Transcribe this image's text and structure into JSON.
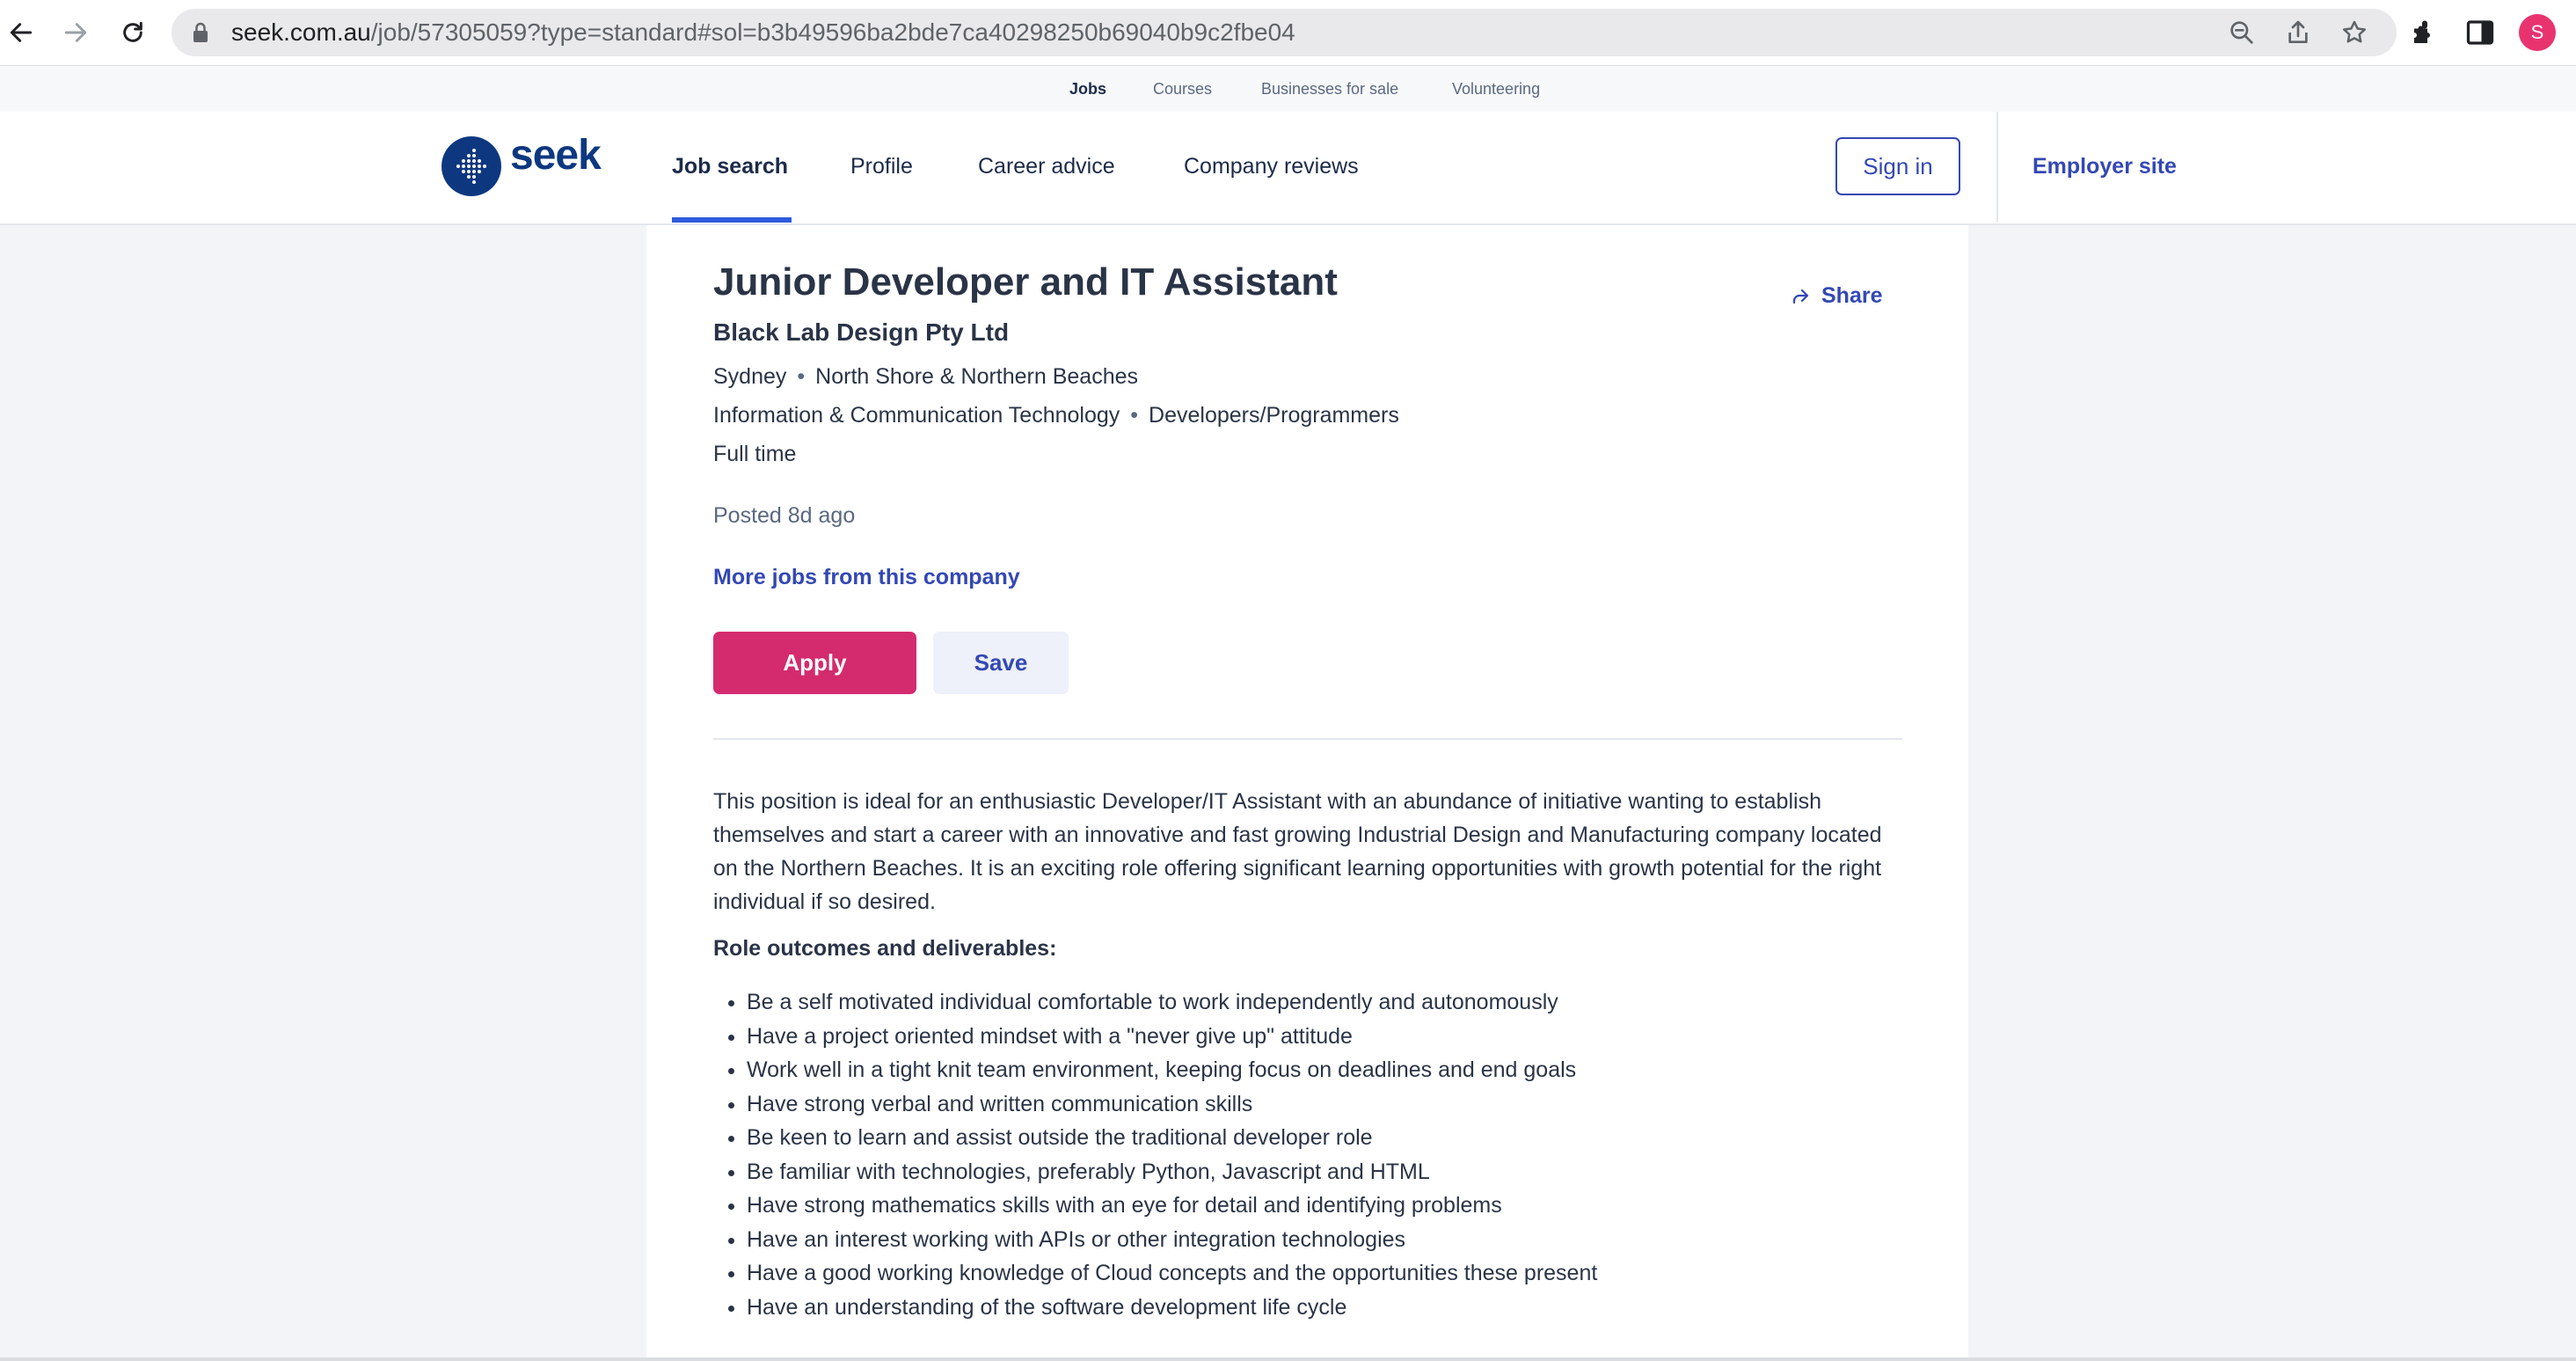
{
  "browser": {
    "url_host": "seek.com.au",
    "url_rest": "/job/57305059?type=standard#sol=b3b49596ba2bde7ca40298250b69040b9c2fbe04",
    "profile_initial": "S"
  },
  "toplinks": {
    "jobs": "Jobs",
    "courses": "Courses",
    "businesses": "Businesses for sale",
    "volunteering": "Volunteering"
  },
  "header": {
    "logo_text": "seek",
    "nav": {
      "job_search": "Job search",
      "profile": "Profile",
      "career_advice": "Career advice",
      "company_reviews": "Company reviews"
    },
    "sign_in": "Sign in",
    "employer_site": "Employer site"
  },
  "job": {
    "title": "Junior Developer and IT Assistant",
    "company": "Black Lab Design Pty Ltd",
    "location": "Sydney",
    "area": "North Shore & Northern Beaches",
    "classification": "Information & Communication Technology",
    "subclassification": "Developers/Programmers",
    "work_type": "Full time",
    "posted": "Posted 8d ago",
    "more_jobs": "More jobs from this company",
    "share": "Share",
    "apply": "Apply",
    "save": "Save",
    "description": "This position is ideal for an enthusiastic Developer/IT Assistant with an abundance of initiative wanting to establish themselves and start a career with an innovative and fast growing Industrial Design and Manufacturing company located on the Northern Beaches. It is an exciting role offering significant learning opportunities with growth potential for the right individual if so desired.",
    "section_heading": "Role outcomes and deliverables:",
    "bullets": [
      "Be a self motivated individual comfortable to work independently and autonomously",
      "Have a project oriented mindset with a \"never give up\" attitude",
      "Work well in a tight knit team environment, keeping focus on deadlines and end goals",
      "Have strong verbal and written communication skills",
      "Be keen to learn and assist outside the traditional developer role",
      "Be familiar with technologies, preferably Python, Javascript and HTML",
      "Have strong mathematics skills with an eye for detail and identifying problems",
      "Have an interest working with APIs or other integration technologies",
      "Have a good working knowledge of Cloud concepts and the opportunities these present",
      "Have an understanding of the software development life cycle"
    ]
  },
  "colors": {
    "brand_blue": "#0d3880",
    "link_blue": "#3348b5",
    "apply_pink": "#d42a6e"
  }
}
